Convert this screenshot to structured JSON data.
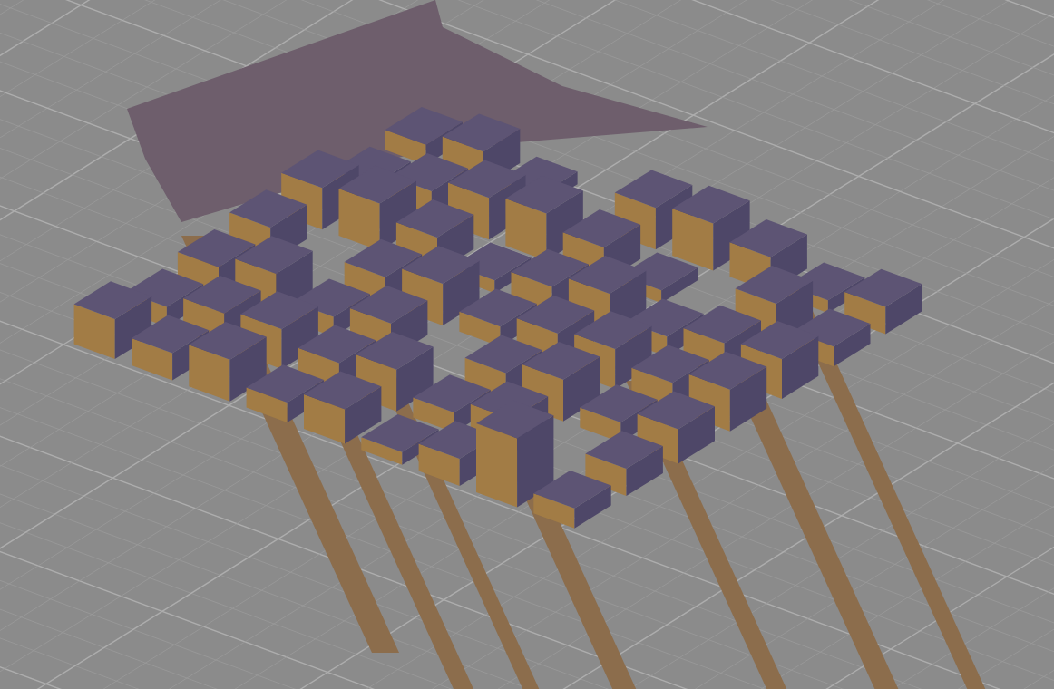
{
  "viewport": {
    "kind": "city-scene",
    "grid": true
  }
}
